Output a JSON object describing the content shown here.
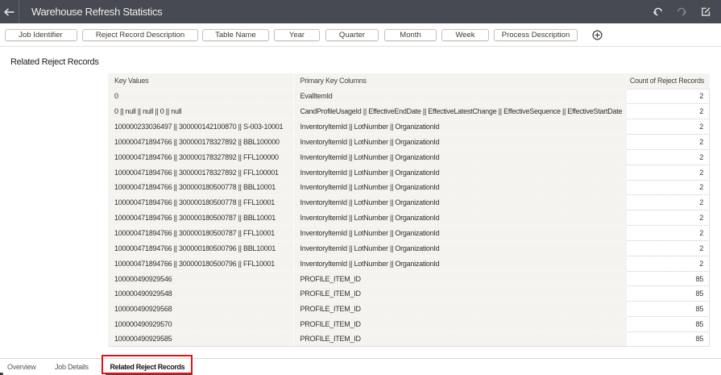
{
  "header": {
    "title": "Warehouse Refresh Statistics",
    "icons": [
      "back-icon",
      "undo-icon",
      "redo-icon",
      "edit-icon"
    ]
  },
  "filters": {
    "chips": [
      "Job Identifier",
      "Reject Record Description",
      "Table Name",
      "Year",
      "Quarter",
      "Month",
      "Week",
      "Process Description"
    ],
    "add_icon": "add-filter-icon"
  },
  "section": {
    "title": "Related Reject Records"
  },
  "table": {
    "columns": [
      "Key Values",
      "Primary Key Columns",
      "Count of Reject Records"
    ],
    "rows": [
      {
        "key": "0",
        "pk": "EvalItemId",
        "count": "2"
      },
      {
        "key": "0 || null || null || 0 || null",
        "pk": "CandProfileUsageId || EffectiveEndDate || EffectiveLatestChange || EffectiveSequence || EffectiveStartDate",
        "count": "2"
      },
      {
        "key": "100000233036497 || 300000142100870 || S-003-10001",
        "pk": "InventoryItemId || LotNumber || OrganizationId",
        "count": "2"
      },
      {
        "key": "100000471894766 || 300000178327892 || BBL100000",
        "pk": "InventoryItemId || LotNumber || OrganizationId",
        "count": "2"
      },
      {
        "key": "100000471894766 || 300000178327892 || FFL100000",
        "pk": "InventoryItemId || LotNumber || OrganizationId",
        "count": "2"
      },
      {
        "key": "100000471894766 || 300000178327892 || FFL100001",
        "pk": "InventoryItemId || LotNumber || OrganizationId",
        "count": "2"
      },
      {
        "key": "100000471894766 || 300000180500778 || BBL10001",
        "pk": "InventoryItemId || LotNumber || OrganizationId",
        "count": "2"
      },
      {
        "key": "100000471894766 || 300000180500778 || FFL10001",
        "pk": "InventoryItemId || LotNumber || OrganizationId",
        "count": "2"
      },
      {
        "key": "100000471894766 || 300000180500787 || BBL10001",
        "pk": "InventoryItemId || LotNumber || OrganizationId",
        "count": "2"
      },
      {
        "key": "100000471894766 || 300000180500787 || FFL10001",
        "pk": "InventoryItemId || LotNumber || OrganizationId",
        "count": "2"
      },
      {
        "key": "100000471894766 || 300000180500796 || BBL10001",
        "pk": "InventoryItemId || LotNumber || OrganizationId",
        "count": "2"
      },
      {
        "key": "100000471894766 || 300000180500796 || FFL10001",
        "pk": "InventoryItemId || LotNumber || OrganizationId",
        "count": "2"
      },
      {
        "key": "100000490929546",
        "pk": "PROFILE_ITEM_ID",
        "count": "85"
      },
      {
        "key": "100000490929548",
        "pk": "PROFILE_ITEM_ID",
        "count": "85"
      },
      {
        "key": "100000490929568",
        "pk": "PROFILE_ITEM_ID",
        "count": "85"
      },
      {
        "key": "100000490929570",
        "pk": "PROFILE_ITEM_ID",
        "count": "85"
      },
      {
        "key": "100000490929585",
        "pk": "PROFILE_ITEM_ID",
        "count": "85"
      }
    ]
  },
  "tabs": {
    "items": [
      {
        "label": "Overview",
        "active": false
      },
      {
        "label": "Job Details",
        "active": false
      },
      {
        "label": "Related Reject Records",
        "active": true
      }
    ]
  },
  "colors": {
    "topbar_bg": "#474a52",
    "chip_border": "#c6c2bb",
    "table_row_bg": "#f4f3f0",
    "annotation_red": "#e81115",
    "active_tab_underline": "#4a4742"
  }
}
